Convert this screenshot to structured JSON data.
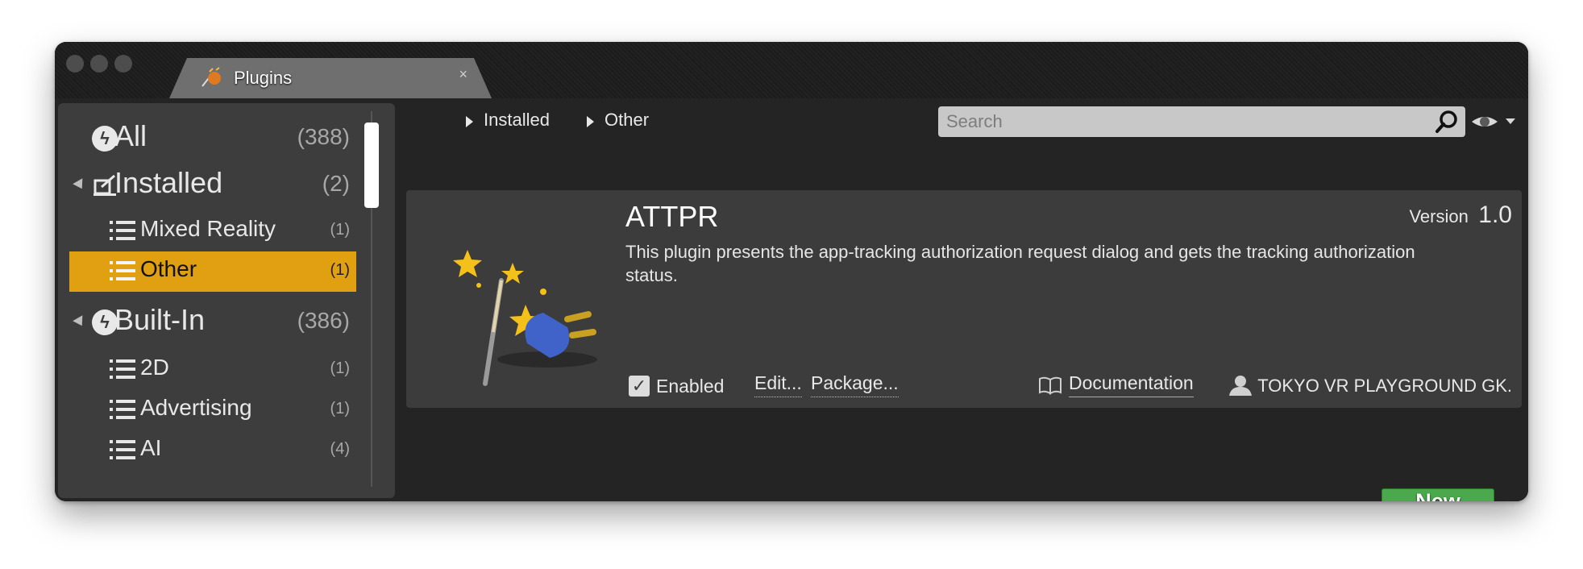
{
  "window": {
    "tab": {
      "title": "Plugins",
      "close": "×"
    }
  },
  "sidebar": {
    "categories": [
      {
        "label": "All",
        "count": "(388)"
      },
      {
        "label": "Installed",
        "count": "(2)",
        "children": [
          {
            "label": "Mixed Reality",
            "count": "(1)"
          },
          {
            "label": "Other",
            "count": "(1)",
            "selected": true
          }
        ]
      },
      {
        "label": "Built-In",
        "count": "(386)",
        "children": [
          {
            "label": "2D",
            "count": "(1)"
          },
          {
            "label": "Advertising",
            "count": "(1)"
          },
          {
            "label": "AI",
            "count": "(4)"
          }
        ]
      }
    ]
  },
  "breadcrumb": [
    "Installed",
    "Other"
  ],
  "search": {
    "placeholder": "Search",
    "value": ""
  },
  "plugin": {
    "name": "ATTPR",
    "version_label": "Version",
    "version": "1.0",
    "description": "This plugin presents the app-tracking authorization request dialog and gets the tracking authorization status.",
    "enabled_label": "Enabled",
    "enabled": true,
    "edit_label": "Edit...",
    "package_label": "Package...",
    "documentation_label": "Documentation",
    "author": "TOKYO VR PLAYGROUND GK."
  },
  "footer": {
    "new_plugin_label": "New Plugin"
  },
  "colors": {
    "selected": "#e0a012",
    "new_plugin": "#4ca84c",
    "panel": "#3d3d3d"
  },
  "icons": [
    "plugin-tab-icon",
    "lightning-icon",
    "installed-icon",
    "list-icon",
    "magic-wand-plug-icon",
    "search-icon",
    "eye-icon",
    "book-icon",
    "user-icon",
    "checkmark-icon"
  ]
}
